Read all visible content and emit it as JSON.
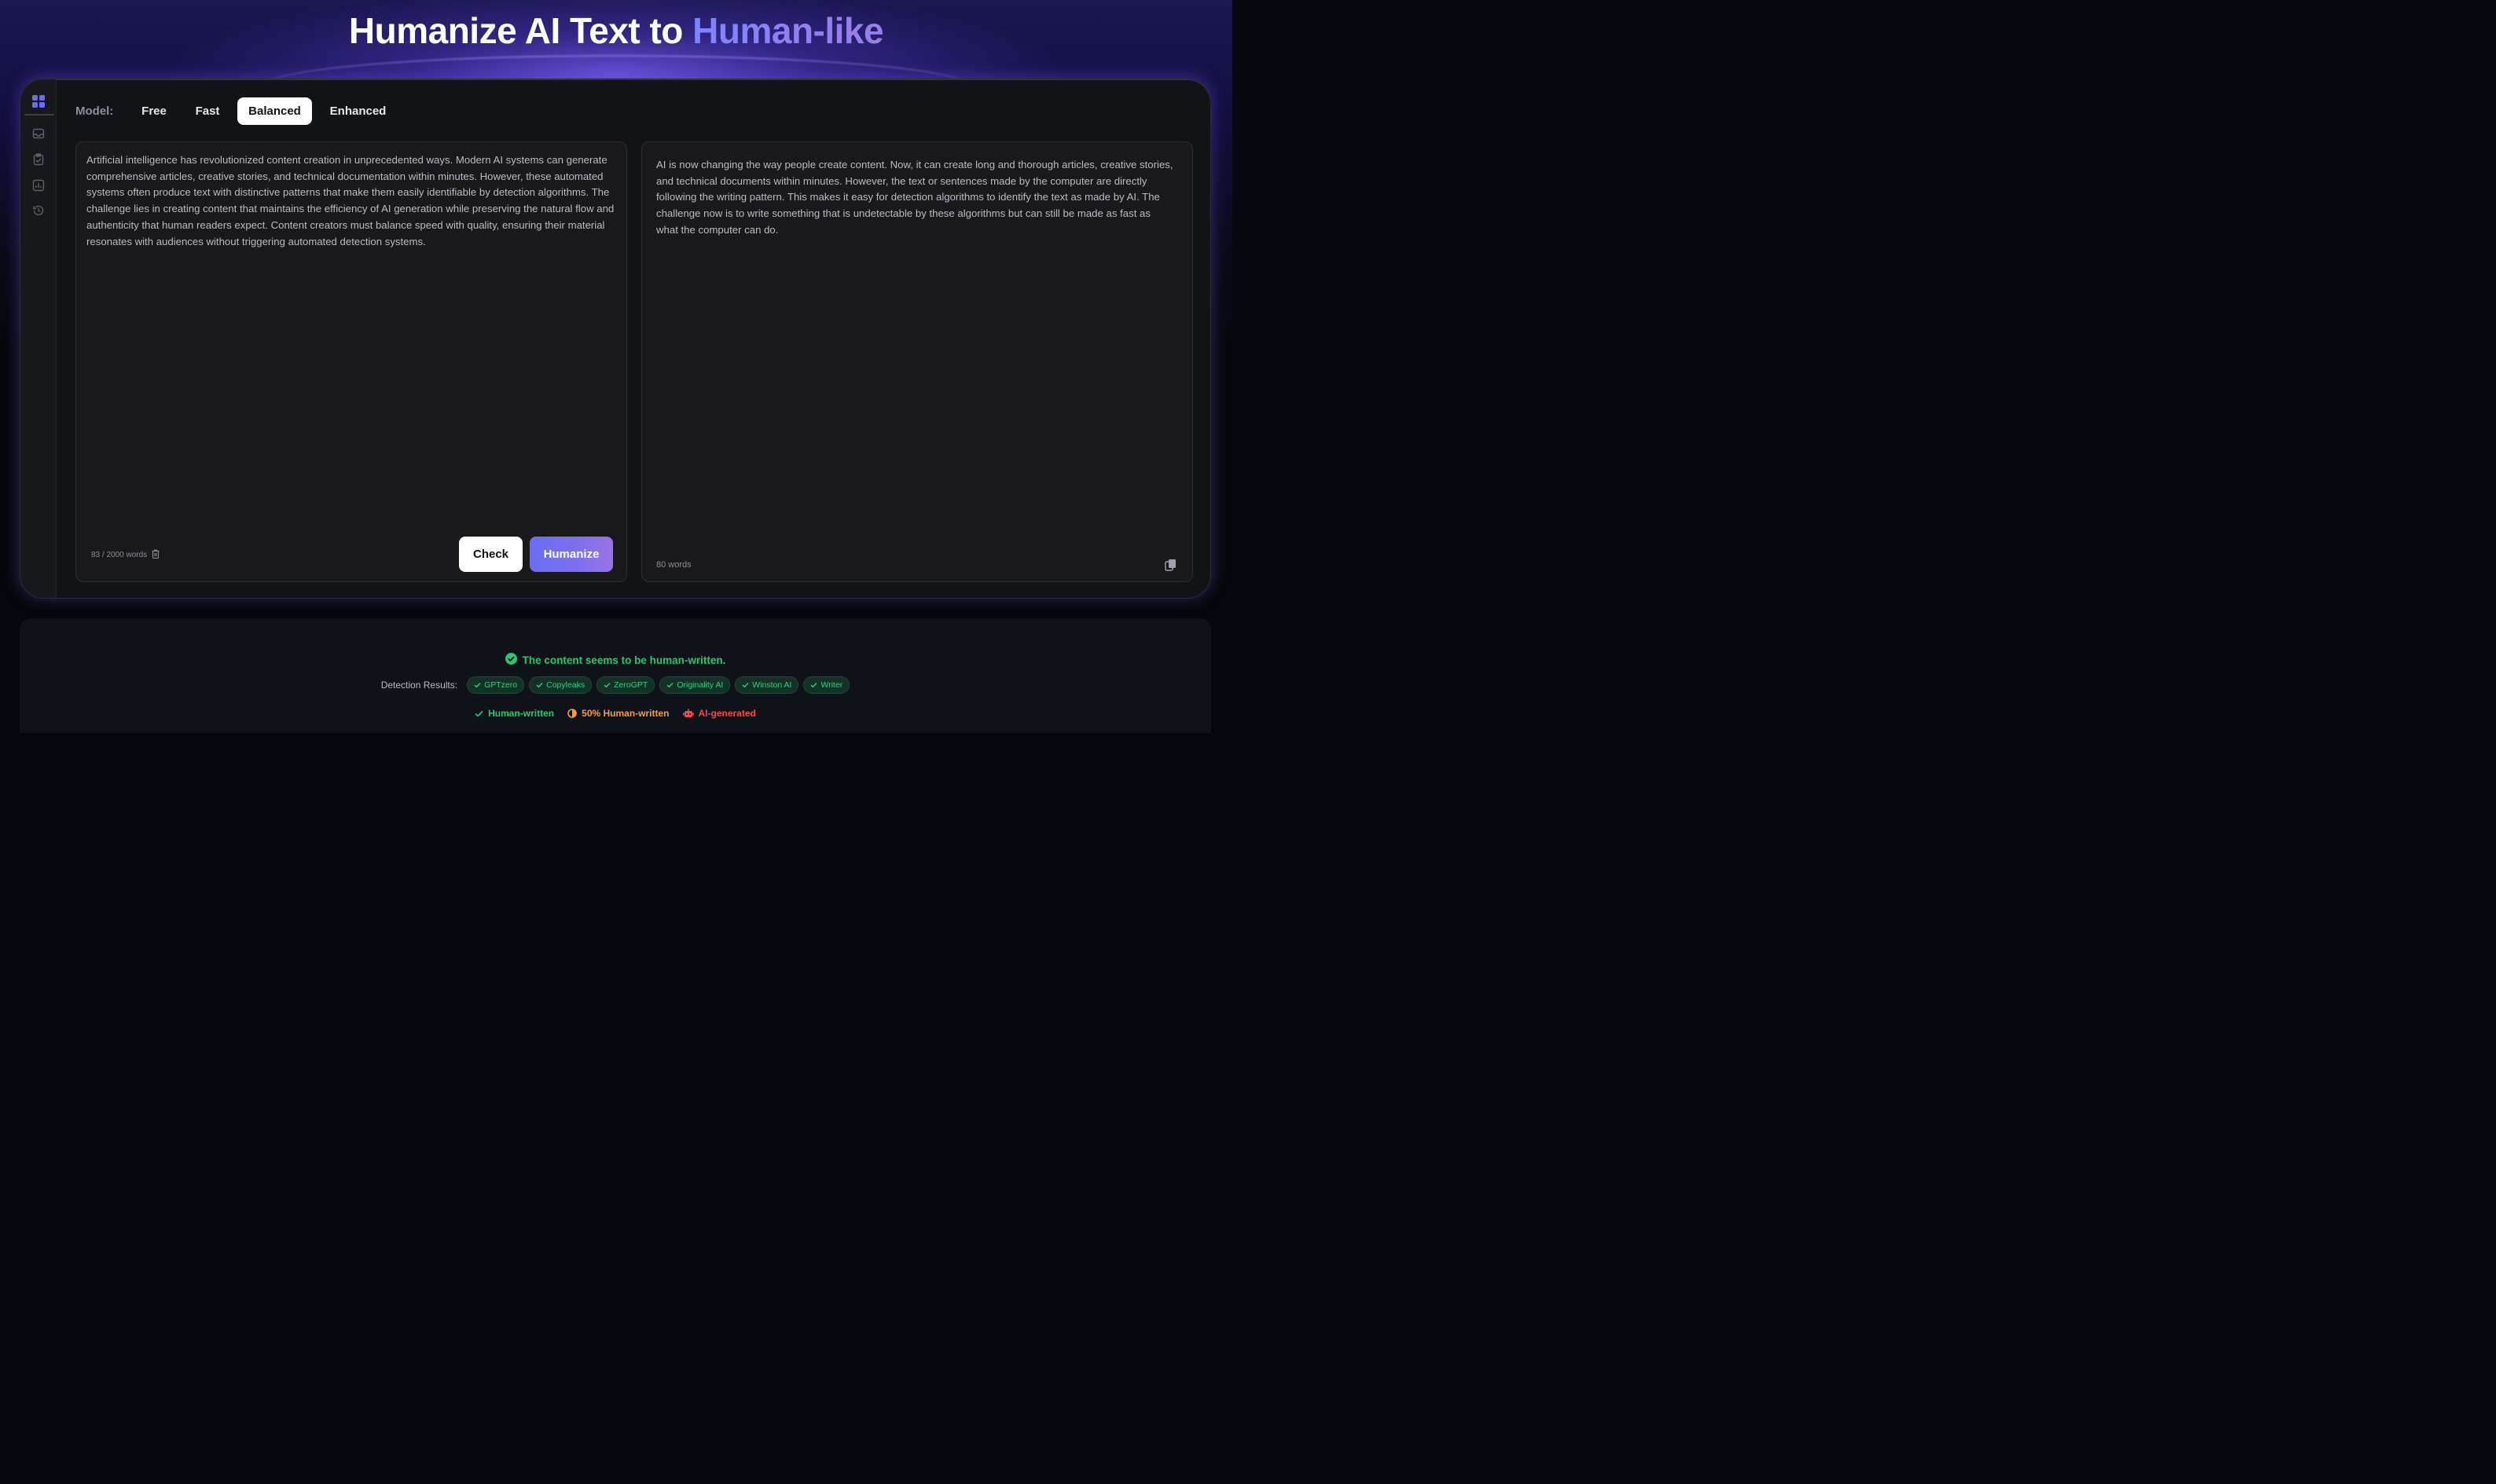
{
  "hero": {
    "title_prefix": "Humanize AI Text to",
    "title_accent": "Human-like"
  },
  "model": {
    "label": "Model:",
    "tabs": [
      {
        "label": "Free",
        "active": false
      },
      {
        "label": "Fast",
        "active": false
      },
      {
        "label": "Balanced",
        "active": true
      },
      {
        "label": "Enhanced",
        "active": false
      }
    ]
  },
  "input": {
    "text": "Artificial intelligence has revolutionized content creation in unprecedented ways. Modern AI systems can generate comprehensive articles, creative stories, and technical documentation within minutes. However, these automated systems often produce text with distinctive patterns that make them easily identifiable by detection algorithms. The challenge lies in creating content that maintains the efficiency of AI generation while preserving the natural flow and authenticity that human readers expect. Content creators must balance speed with quality, ensuring their material resonates with audiences without triggering automated detection systems.",
    "word_count": "83 / 2000 words",
    "check_label": "Check",
    "humanize_label": "Humanize"
  },
  "output": {
    "text": "AI is now changing the way people create content. Now, it can create long and thorough articles, creative stories, and technical documents within minutes. However, the text or sentences made by the computer are directly following the writing pattern. This makes it easy for detection algorithms to identify the text as made by AI. The challenge now is to write something that is undetectable by these algorithms but can still be made as fast as what the computer can do.",
    "word_count": "80 words"
  },
  "results": {
    "status": "The content seems to be human-written.",
    "detection_label": "Detection Results:",
    "detectors": [
      "GPTzero",
      "Copyleaks",
      "ZeroGPT",
      "Originality AI",
      "Winston AI",
      "Writer"
    ],
    "legend": {
      "human": "Human-written",
      "half": "50% Human-written",
      "ai": "AI-generated"
    }
  },
  "colors": {
    "accent": "#6a6df2",
    "success": "#28c76f",
    "warning": "#f39c3d",
    "danger": "#ef4a4a"
  },
  "icons": [
    "grid-icon",
    "inbox-icon",
    "clipboard-icon",
    "chart-icon",
    "history-icon",
    "trash-icon",
    "copy-icon",
    "check-circle-icon",
    "check-icon",
    "half-circle-icon",
    "robot-icon"
  ]
}
